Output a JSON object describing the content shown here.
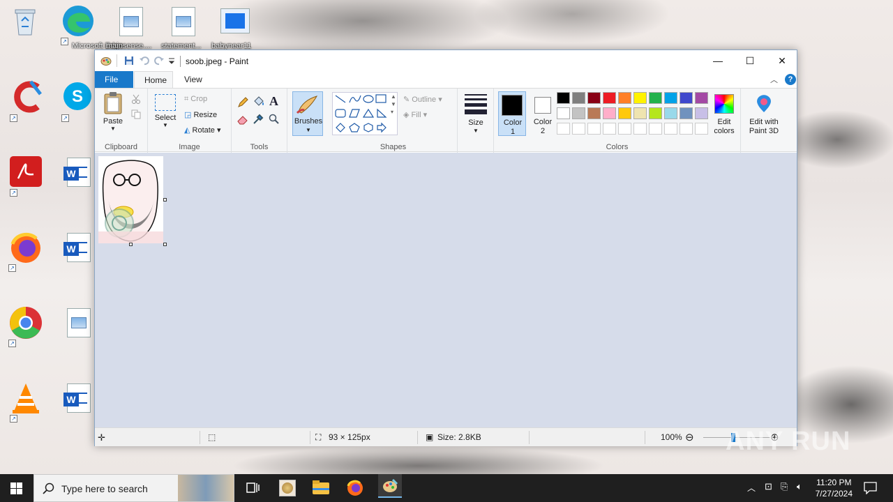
{
  "desktop": {
    "icons": [
      {
        "name": "recycle-bin",
        "label": ""
      },
      {
        "name": "edge",
        "label": "Microsoft Edge"
      },
      {
        "name": "file-mainsense",
        "label": "mainsense...."
      },
      {
        "name": "file-statement",
        "label": "statement..."
      },
      {
        "name": "file-babynear",
        "label": "babynear11"
      },
      {
        "name": "ccleaner",
        "label": ""
      },
      {
        "name": "skype",
        "label": "Skype"
      },
      {
        "name": "acrobat",
        "label": ""
      },
      {
        "name": "word-doc-1",
        "label": ""
      },
      {
        "name": "firefox",
        "label": ""
      },
      {
        "name": "word-doc-2",
        "label": ""
      },
      {
        "name": "chrome",
        "label": ""
      },
      {
        "name": "image-file",
        "label": ""
      },
      {
        "name": "vlc",
        "label": ""
      },
      {
        "name": "word-doc-3",
        "label": ""
      }
    ]
  },
  "window": {
    "title": "soob.jpeg - Paint",
    "controls": {
      "minimize": "—",
      "maximize": "☐",
      "close": "✕"
    }
  },
  "tabs": {
    "file": "File",
    "home": "Home",
    "view": "View"
  },
  "ribbon": {
    "clipboard": {
      "paste": "Paste",
      "label": "Clipboard"
    },
    "image": {
      "select": "Select",
      "crop": "Crop",
      "resize": "Resize",
      "rotate": "Rotate",
      "label": "Image"
    },
    "tools": {
      "label": "Tools"
    },
    "brushes": {
      "label": "Brushes"
    },
    "shapes": {
      "outline": "Outline",
      "fill": "Fill",
      "label": "Shapes"
    },
    "size": {
      "label": "Size"
    },
    "colors": {
      "color1": "Color\n1",
      "color1_a": "Color",
      "color1_b": "1",
      "color2_a": "Color",
      "color2_b": "2",
      "edit_a": "Edit",
      "edit_b": "colors",
      "paint3d_a": "Edit with",
      "paint3d_b": "Paint 3D",
      "label": "Colors",
      "palette_row1": [
        "#000000",
        "#7f7f7f",
        "#880015",
        "#ed1c24",
        "#ff7f27",
        "#fff200",
        "#22b14c",
        "#00a2e8",
        "#3f48cc",
        "#a349a4"
      ],
      "palette_row2": [
        "#ffffff",
        "#c3c3c3",
        "#b97a57",
        "#ffaec9",
        "#ffc90e",
        "#efe4b0",
        "#b5e61d",
        "#99d9ea",
        "#7092be",
        "#c8bfe7"
      ],
      "palette_row3": [
        "#ffffff",
        "#ffffff",
        "#ffffff",
        "#ffffff",
        "#ffffff",
        "#ffffff",
        "#ffffff",
        "#ffffff",
        "#ffffff",
        "#ffffff"
      ],
      "primary": "#000000",
      "secondary": "#ffffff"
    }
  },
  "status": {
    "dimensions": "93 × 125px",
    "size": "Size: 2.8KB",
    "zoom": "100%"
  },
  "taskbar": {
    "search_placeholder": "Type here to search",
    "time": "11:20 PM",
    "date": "7/27/2024"
  },
  "watermark": "ANY RUN"
}
